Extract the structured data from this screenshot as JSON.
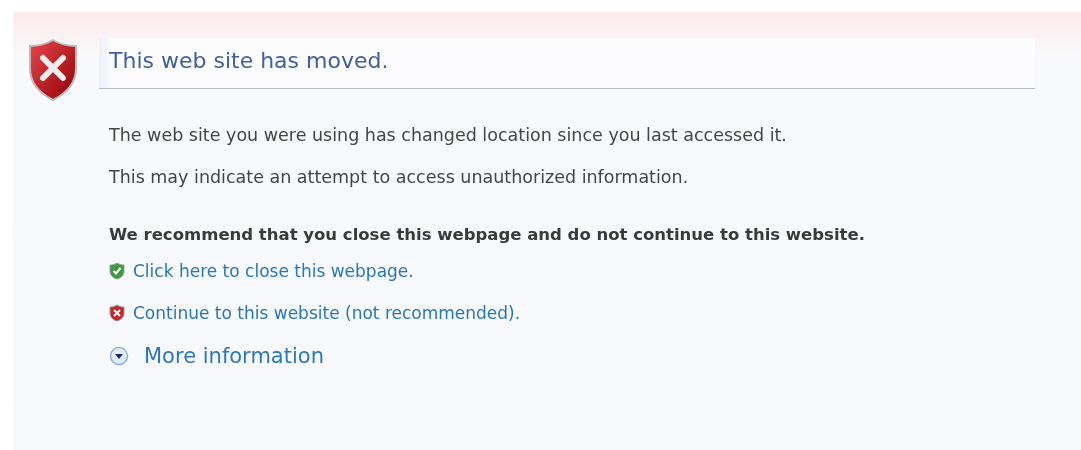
{
  "title": "This web site has moved.",
  "paragraphs": [
    "The web site you were using has changed location since you last accessed it.",
    "This may indicate an attempt to access unauthorized information."
  ],
  "recommendation": "We recommend that you close this webpage and do not continue to this website.",
  "links": [
    {
      "kind": "safe",
      "label": "Click here to close this webpage."
    },
    {
      "kind": "unsafe",
      "label": "Continue to this website (not recommended)."
    }
  ],
  "more_information": {
    "label": "More information",
    "expanded": false
  }
}
